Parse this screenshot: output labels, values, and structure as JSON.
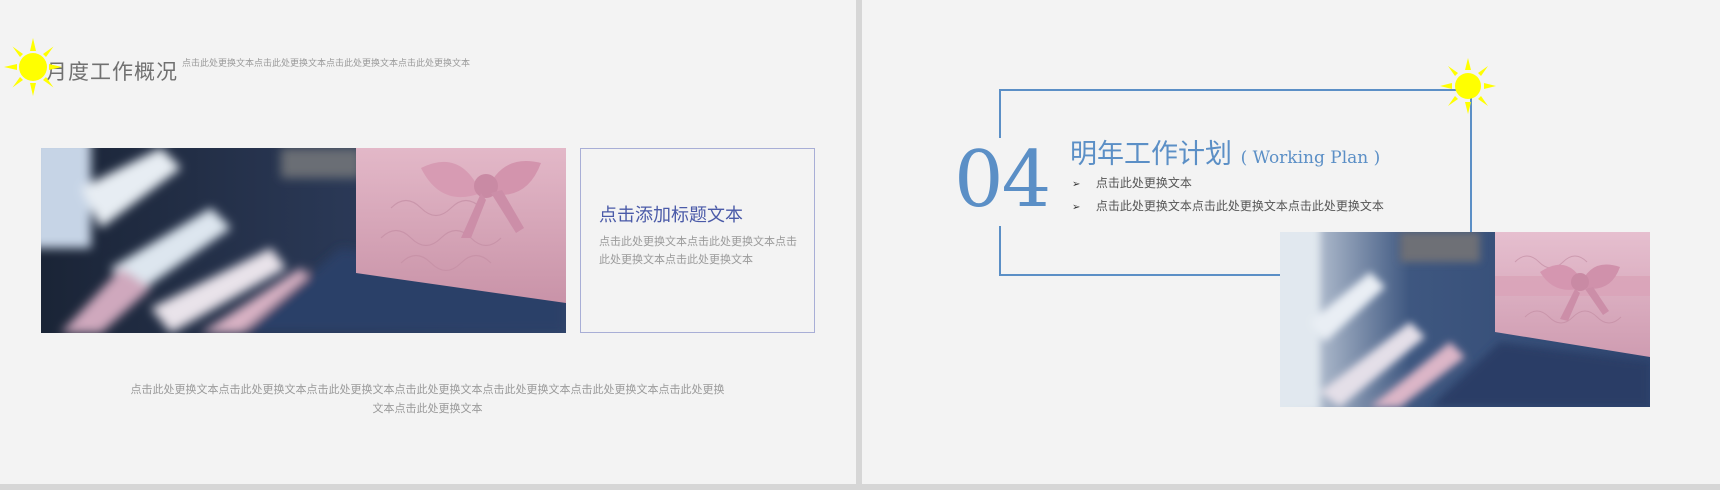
{
  "left_slide": {
    "title": "月度工作概况",
    "subtitle": "点击此处更换文本点击此处更换文本点击此处更换文本点击此处更换文本",
    "card": {
      "title": "点击添加标题文本",
      "body": "点击此处更换文本点击此处更换文本点击此处更换文本点击此处更换文本"
    },
    "bottom_text": "点击此处更换文本点击此处更换文本点击此处更换文本点击此处更换文本点击此处更换文本点击此处更换文本点击此处更换文本点击此处更换文本"
  },
  "right_slide": {
    "number": "04",
    "title": "明年工作计划",
    "title_en": "( Working Plan )",
    "bullets": [
      "点击此处更换文本",
      "点击此处更换文本点击此处更换文本点击此处更换文本"
    ]
  },
  "colors": {
    "accent_blue": "#5b8fc6",
    "card_title": "#4a5aa8",
    "sun": "#ffff00",
    "slide_bg": "#f3f3f3"
  },
  "icons": {
    "sun": "sun-icon",
    "bullet": "arrow-bullet-icon"
  }
}
